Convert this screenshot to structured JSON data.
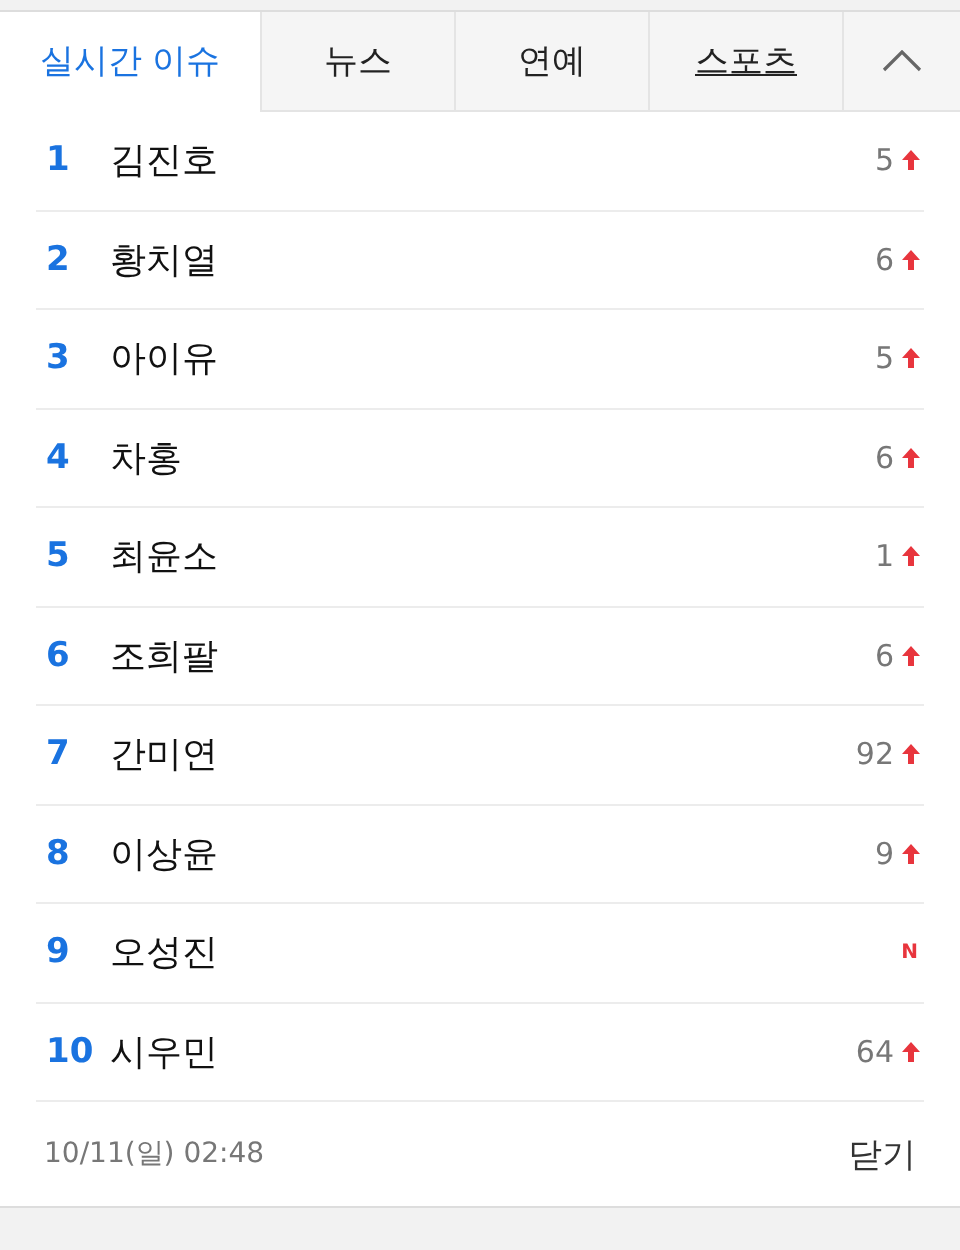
{
  "tabs": [
    {
      "label": "실시간 이슈",
      "selected": true,
      "underlined": false
    },
    {
      "label": "뉴스",
      "selected": false,
      "underlined": false
    },
    {
      "label": "연예",
      "selected": false,
      "underlined": false
    },
    {
      "label": "스포츠",
      "selected": false,
      "underlined": true
    }
  ],
  "ranking": [
    {
      "rank": "1",
      "name": "김진호",
      "kind": "up",
      "change": "5"
    },
    {
      "rank": "2",
      "name": "황치열",
      "kind": "up",
      "change": "6"
    },
    {
      "rank": "3",
      "name": "아이유",
      "kind": "up",
      "change": "5"
    },
    {
      "rank": "4",
      "name": "차홍",
      "kind": "up",
      "change": "6"
    },
    {
      "rank": "5",
      "name": "최윤소",
      "kind": "up",
      "change": "1"
    },
    {
      "rank": "6",
      "name": "조희팔",
      "kind": "up",
      "change": "6"
    },
    {
      "rank": "7",
      "name": "간미연",
      "kind": "up",
      "change": "92"
    },
    {
      "rank": "8",
      "name": "이상윤",
      "kind": "up",
      "change": "9"
    },
    {
      "rank": "9",
      "name": "오성진",
      "kind": "new",
      "change": "N"
    },
    {
      "rank": "10",
      "name": "시우민",
      "kind": "up",
      "change": "64"
    }
  ],
  "footer": {
    "timestamp": "10/11(일) 02:48",
    "close_label": "닫기"
  }
}
